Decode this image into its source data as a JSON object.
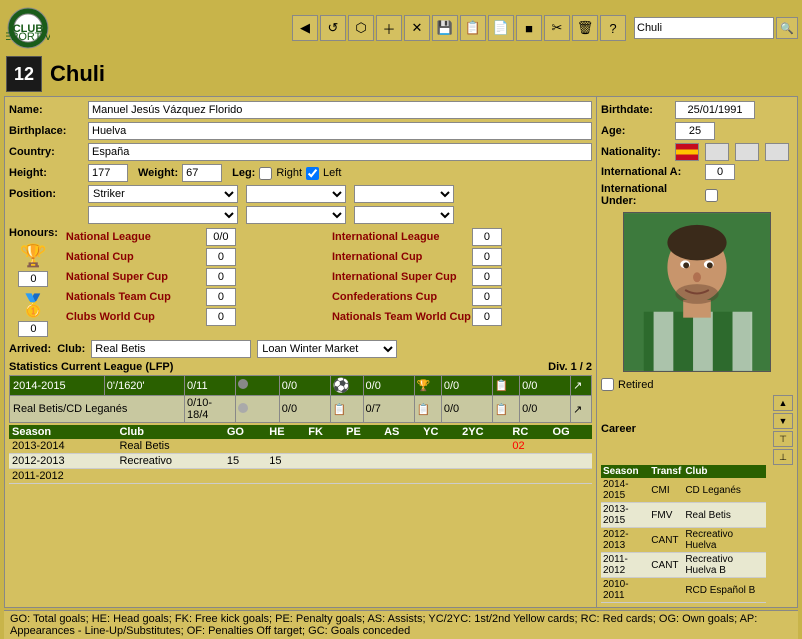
{
  "toolbar": {
    "icons": [
      "◀",
      "↺",
      "⬡",
      "＋",
      "✕",
      "🖫",
      "🖬",
      "🖫",
      "◼",
      "✂",
      "🗑",
      "?"
    ],
    "search_placeholder": "Chuli",
    "search_value": "Chuli"
  },
  "player": {
    "number": "12",
    "name": "Chuli",
    "full_name": "Manuel Jesús Vázquez Florido",
    "birthplace": "Huelva",
    "country": "España",
    "height": "177",
    "weight": "67",
    "leg_right": false,
    "leg_left": true,
    "position": "Striker",
    "birthdate": "25/01/1991",
    "age": "25",
    "nationality": "España",
    "international_a": "0",
    "international_under": ""
  },
  "honours": {
    "national_league": "0/0",
    "international_league": "0",
    "national_cup": "0",
    "international_cup": "0",
    "national_super_cup": "0",
    "international_super_cup": "0",
    "nationals_team_cup": "0",
    "confederations_cup": "0",
    "clubs_world_cup": "0",
    "nationals_team_world_cup": "0",
    "trophy1_val": "0",
    "trophy2_val": "0"
  },
  "arrived": {
    "label": "Arrived:",
    "club_label": "Club:",
    "club": "Real Betis",
    "loan": "Loan Winter Market"
  },
  "statistics": {
    "title": "Statistics Current League (LFP)",
    "div": "Div. 1 / 2",
    "season": "2014-2015",
    "minutes": "0'/1620'",
    "row1": {
      "goals": "0/11",
      "stat2": "0/0",
      "stat3": "0/0",
      "stat4": "0/0",
      "stat5": "0/0"
    },
    "team": "Real Betis/CD Leganés",
    "row2": {
      "apps": "0/10-18/4",
      "stat2": "0/0",
      "stat3": "0/7",
      "stat4": "0/0",
      "stat5": "0/0"
    }
  },
  "season_history": {
    "columns": [
      "Season",
      "Club",
      "GO",
      "HE",
      "FK",
      "PE",
      "AS",
      "YC",
      "2YC",
      "RC",
      "OG"
    ],
    "rows": [
      {
        "season": "2013-2014",
        "club": "Real Betis",
        "go": "",
        "he": "",
        "fk": "",
        "pe": "",
        "as": "",
        "yc": "",
        "two_yc": "",
        "rc": "02",
        "og": ""
      },
      {
        "season": "2012-2013",
        "club": "Recreativo",
        "go": "15",
        "he": "15",
        "fk": "",
        "pe": "",
        "as": "",
        "yc": "",
        "two_yc": "",
        "rc": "",
        "og": ""
      },
      {
        "season": "2011-2012",
        "club": "",
        "go": "",
        "he": "",
        "fk": "",
        "pe": "",
        "as": "",
        "yc": "",
        "two_yc": "",
        "rc": "",
        "og": ""
      }
    ]
  },
  "career": {
    "title": "Career",
    "columns": [
      "Season",
      "Transf",
      "Club"
    ],
    "rows": [
      {
        "season": "2014-2015",
        "transf": "CMI",
        "club": "CD Leganés"
      },
      {
        "season": "2013-2015",
        "transf": "FMV",
        "club": "Real Betis"
      },
      {
        "season": "2012-2013",
        "transf": "CANT",
        "club": "Recreativo Huelva"
      },
      {
        "season": "2011-2012",
        "transf": "CANT",
        "club": "Recreativo Huelva B"
      },
      {
        "season": "2010-2011",
        "transf": "",
        "club": "RCD Español B"
      }
    ]
  },
  "footer": {
    "text": "GO: Total goals; HE: Head goals; FK: Free kick goals; PE: Penalty goals; AS: Assists; YC/2YC: 1st/2nd Yellow cards; RC: Red cards; OG: Own goals; AP: Appearances - Line-Up/Substitutes; OF: Penalties Off target; GC: Goals conceded"
  },
  "labels": {
    "name": "Name:",
    "birthplace": "Birthplace:",
    "country": "Country:",
    "height": "Height:",
    "weight": "Weight:",
    "leg": "Leg:",
    "right": "Right",
    "left": "Left",
    "position": "Position:",
    "honours": "Honours:",
    "birthdate": "Birthdate:",
    "age": "Age:",
    "nationality": "Nationality:",
    "intl_a": "International A:",
    "intl_under": "International Under:",
    "retired": "Retired"
  }
}
